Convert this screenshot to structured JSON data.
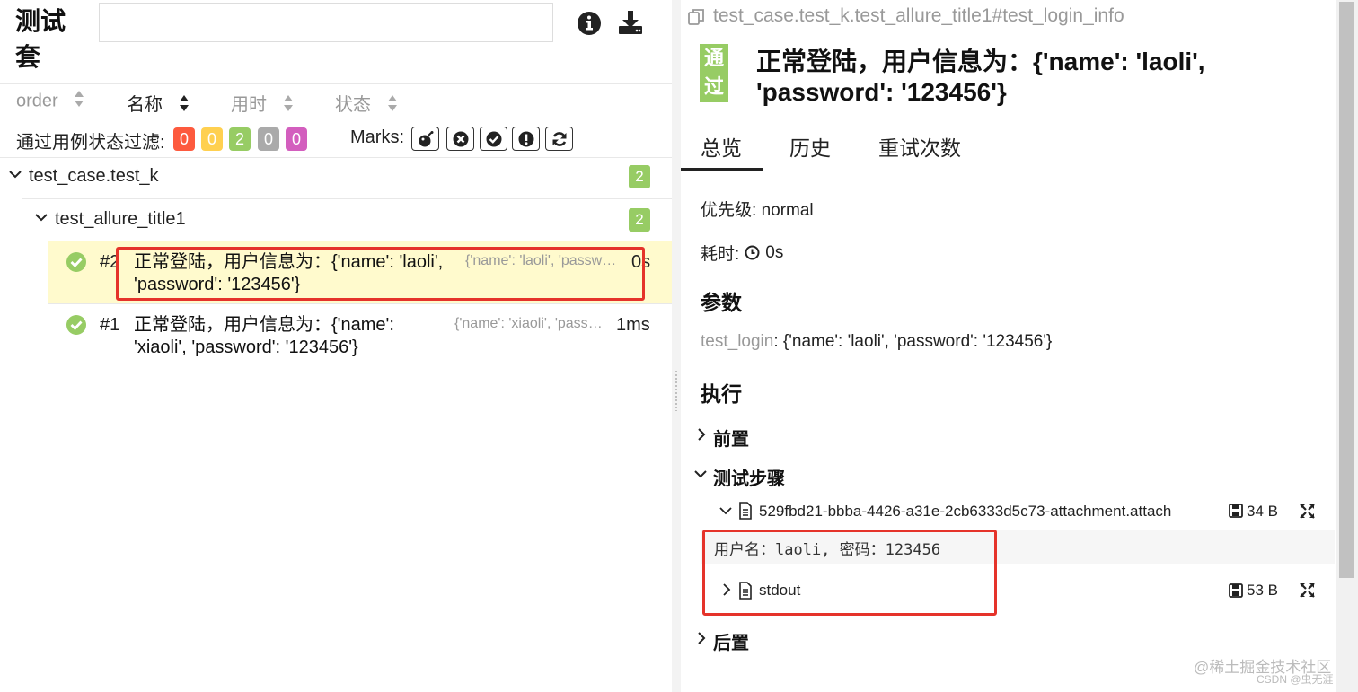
{
  "left": {
    "suite_title": "测试套",
    "search": {
      "value": "",
      "placeholder": ""
    },
    "info_icon": "info-icon",
    "download_icon": "download-icon",
    "columns": [
      {
        "label": "order",
        "active": false
      },
      {
        "label": "名称",
        "active": true
      },
      {
        "label": "用时",
        "active": false
      },
      {
        "label": "状态",
        "active": false
      }
    ],
    "filter": {
      "label": "通过用例状态过滤:",
      "badges": [
        {
          "count": "0",
          "color": "#fd5a3e"
        },
        {
          "count": "0",
          "color": "#ffd050"
        },
        {
          "count": "2",
          "color": "#97cc64"
        },
        {
          "count": "0",
          "color": "#aaaaaa"
        },
        {
          "count": "0",
          "color": "#d35ebe"
        }
      ]
    },
    "marks": {
      "label": "Marks:",
      "icons": [
        "bomb-icon",
        "times-circle-icon",
        "check-circle-icon",
        "exclamation-circle-icon",
        "refresh-icon"
      ]
    },
    "tree": {
      "suite": {
        "name": "test_case.test_k",
        "count": "2"
      },
      "class": {
        "name": "test_allure_title1",
        "count": "2"
      },
      "cases": [
        {
          "num": "#2",
          "title_line1": "正常登陆，用户信息为：{'name': 'laoli',",
          "title_line2": "'password': '123456'}",
          "params": "{'name': 'laoli', 'password': '123456'}",
          "duration": "0s",
          "selected": true
        },
        {
          "num": "#1",
          "title_line1": "正常登陆，用户信息为：{'name':",
          "title_line2": "'xiaoli', 'password': '123456'}",
          "params": "{'name': 'xiaoli', 'password': '123456'}",
          "duration": "1ms",
          "selected": false
        }
      ]
    }
  },
  "right": {
    "path": "test_case.test_k.test_allure_title1#test_login_info",
    "status_badge": "通过",
    "title_line1": "正常登陆，用户信息为：{'name': 'laoli',",
    "title_line2": "'password': '123456'}",
    "tabs": [
      "总览",
      "历史",
      "重试次数"
    ],
    "active_tab": "总览",
    "severity_label": "优先级:",
    "severity_value": "normal",
    "duration_label": "耗时:",
    "duration_value": "0s",
    "params_title": "参数",
    "param_name": "test_login",
    "param_value": ": {'name': 'laoli', 'password': '123456'}",
    "execution_title": "执行",
    "setup_label": "前置",
    "steps_label": "测试步骤",
    "attachment": {
      "name": "529fbd21-bbba-4426-a31e-2cb6333d5c73-attachment.attach",
      "size": "34 B",
      "content": "用户名：laoli, 密码：123456"
    },
    "stdout": {
      "name": "stdout",
      "size": "53 B"
    },
    "teardown_label": "后置"
  },
  "watermark": {
    "line1": "@稀土掘金技术社区",
    "line2": "CSDN @虫无涯"
  }
}
